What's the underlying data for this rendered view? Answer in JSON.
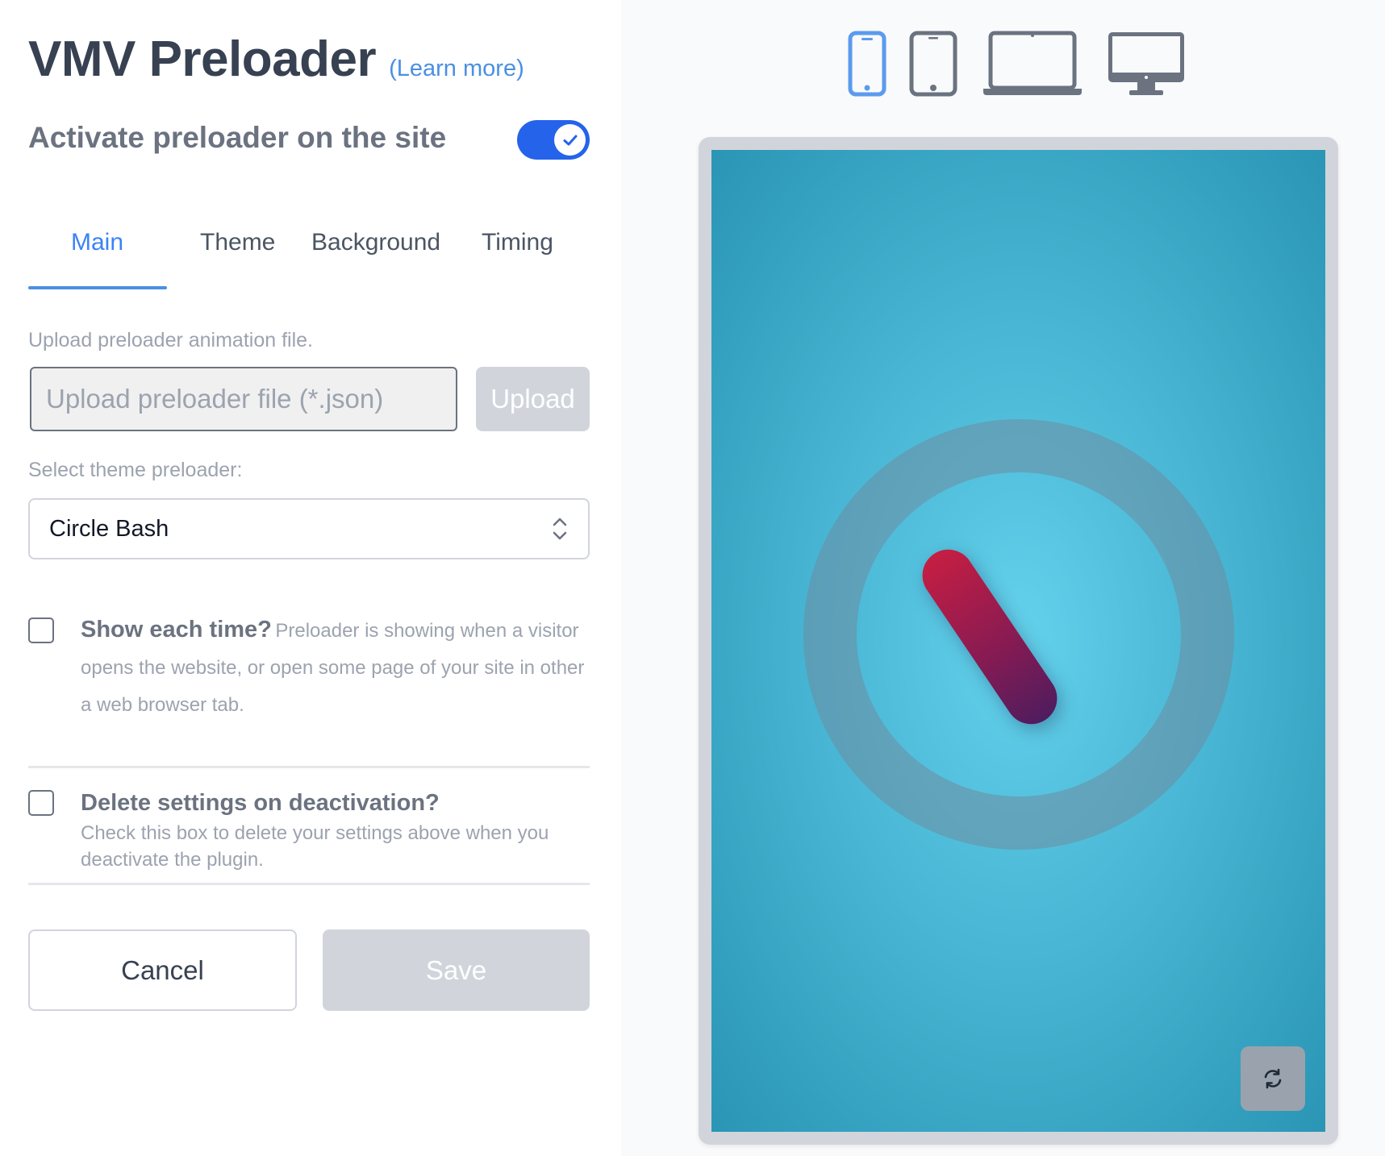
{
  "header": {
    "title": "VMV Preloader",
    "learn_more": "(Learn more)"
  },
  "activate": {
    "label": "Activate preloader on the site",
    "enabled": true
  },
  "tabs": [
    {
      "label": "Main",
      "active": true
    },
    {
      "label": "Theme",
      "active": false
    },
    {
      "label": "Background",
      "active": false
    },
    {
      "label": "Timing",
      "active": false
    }
  ],
  "upload": {
    "label": "Upload preloader animation file.",
    "placeholder": "Upload preloader file (*.json)",
    "button": "Upload"
  },
  "theme_select": {
    "label": "Select theme preloader:",
    "value": "Circle Bash"
  },
  "options": {
    "show_each_time": {
      "title": "Show each time?",
      "description": "Preloader is showing when a visitor opens the website, or open some page of your site in other a web browser tab.",
      "checked": false
    },
    "delete_settings": {
      "title": "Delete settings on deactivation?",
      "description": "Check this box to delete your settings above when you deactivate the plugin.",
      "checked": false
    }
  },
  "actions": {
    "cancel": "Cancel",
    "save": "Save"
  },
  "preview": {
    "devices": [
      "phone-icon",
      "tablet-icon",
      "laptop-icon",
      "desktop-icon"
    ],
    "active_device": "phone-icon",
    "colors": {
      "accent": "#2563eb",
      "active_device": "#5b9bef",
      "inactive_device": "#6b7280",
      "preview_bg": "#48b6d4"
    }
  }
}
